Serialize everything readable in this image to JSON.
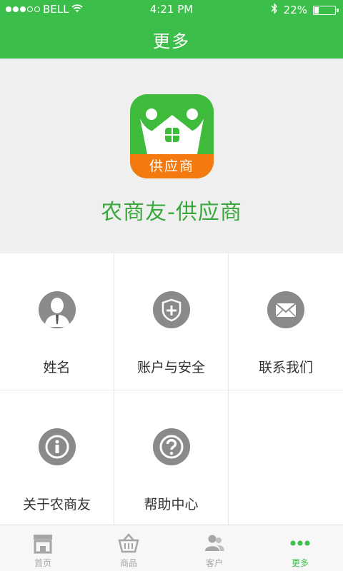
{
  "status_bar": {
    "carrier": "BELL",
    "time": "4:21 PM",
    "battery": "22%",
    "battery_level": 0.22
  },
  "header": {
    "title": "更多"
  },
  "hero": {
    "logo_text": "供应商",
    "app_name": "农商友-供应商"
  },
  "menu": [
    {
      "label": "姓名",
      "icon": "user-icon"
    },
    {
      "label": "账户与安全",
      "icon": "shield-icon"
    },
    {
      "label": "联系我们",
      "icon": "mail-icon"
    },
    {
      "label": "关于农商友",
      "icon": "info-icon"
    },
    {
      "label": "帮助中心",
      "icon": "help-icon"
    }
  ],
  "tabs": [
    {
      "label": "首页",
      "icon": "store-icon"
    },
    {
      "label": "商品",
      "icon": "basket-icon"
    },
    {
      "label": "客户",
      "icon": "customers-icon"
    },
    {
      "label": "更多",
      "icon": "more-icon",
      "active": true
    }
  ],
  "colors": {
    "brand": "#3bbf4a",
    "accent": "#f47a10",
    "icon_gray": "#8a8a8a"
  }
}
